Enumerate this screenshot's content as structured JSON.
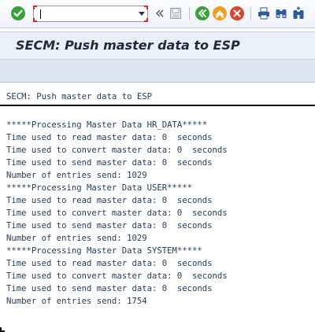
{
  "toolbar": {
    "command_field": {
      "value": "",
      "placeholder": ""
    },
    "icons": [
      "enter-icon",
      "command-dropdown-icon",
      "collapse-arrows-icon",
      "save-icon",
      "back-icon",
      "exit-icon",
      "cancel-icon",
      "print-icon",
      "find-icon",
      "find-next-icon"
    ]
  },
  "title": {
    "text": "SECM: Push master data to ESP"
  },
  "list": {
    "heading": "SECM: Push master data to ESP",
    "lines": [
      "*****Processing Master Data HR_DATA*****",
      "Time used to read master data: 0  seconds",
      "Time used to convert master data: 0  seconds",
      "Time used to send master data: 0  seconds",
      "Number of entries send: 1029",
      "*****Processing Master Data USER*****",
      "Time used to read master data: 0  seconds",
      "Time used to convert master data: 0  seconds",
      "Time used to send master data: 0  seconds",
      "Number of entries send: 1029",
      "*****Processing Master Data SYSTEM*****",
      "Time used to read master data: 0  seconds",
      "Time used to convert master data: 0  seconds",
      "Time used to send master data: 0  seconds",
      "Number of entries send: 1754"
    ]
  },
  "colors": {
    "enter": "#3aa13a",
    "back": "#3aa13a",
    "exit": "#f0a020",
    "cancel": "#d9442b",
    "toolbar_icons": "#2c5d9a",
    "text": "#1f3b5a"
  }
}
